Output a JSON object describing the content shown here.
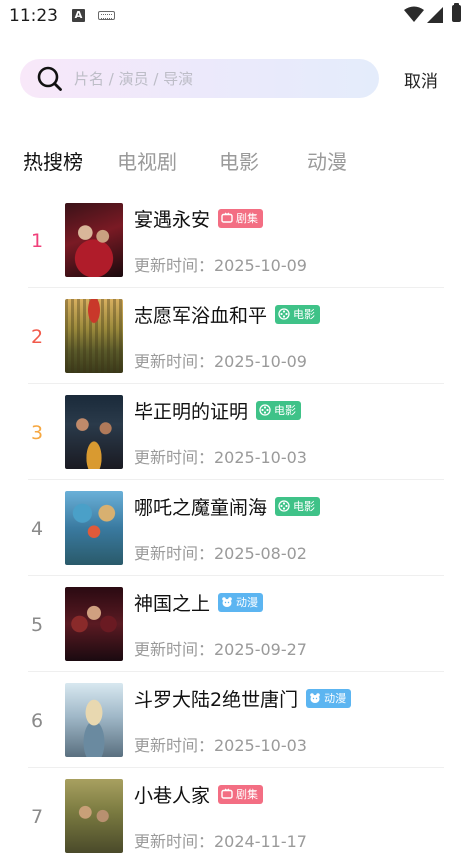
{
  "status_bar": {
    "time": "11:23",
    "notification_letter": "A"
  },
  "search": {
    "placeholder": "片名 / 演员 / 导演",
    "value": "",
    "cancel_label": "取消"
  },
  "tabs": [
    {
      "label": "热搜榜",
      "active": true
    },
    {
      "label": "电视剧",
      "active": false
    },
    {
      "label": "电影",
      "active": false
    },
    {
      "label": "动漫",
      "active": false
    }
  ],
  "list": [
    {
      "rank": "1",
      "title": "宴遇永安",
      "badge": "剧集",
      "badge_type": "series",
      "updated": "更新时间：2025-10-09",
      "rank_color": "#f0407a"
    },
    {
      "rank": "2",
      "title": "志愿军浴血和平",
      "badge": "电影",
      "badge_type": "movie",
      "updated": "更新时间：2025-10-09",
      "rank_color": "#f15a4b"
    },
    {
      "rank": "3",
      "title": "毕正明的证明",
      "badge": "电影",
      "badge_type": "movie",
      "updated": "更新时间：2025-10-03",
      "rank_color": "#f6a740"
    },
    {
      "rank": "4",
      "title": "哪吒之魔童闹海",
      "badge": "电影",
      "badge_type": "movie",
      "updated": "更新时间：2025-08-02",
      "rank_color": "#8a8a8a"
    },
    {
      "rank": "5",
      "title": "神国之上",
      "badge": "动漫",
      "badge_type": "anime",
      "updated": "更新时间：2025-09-27",
      "rank_color": "#8a8a8a"
    },
    {
      "rank": "6",
      "title": "斗罗大陆2绝世唐门",
      "badge": "动漫",
      "badge_type": "anime",
      "updated": "更新时间：2025-10-03",
      "rank_color": "#8a8a8a"
    },
    {
      "rank": "7",
      "title": "小巷人家",
      "badge": "剧集",
      "badge_type": "series",
      "updated": "更新时间：2024-11-17",
      "rank_color": "#8a8a8a"
    }
  ],
  "colors": {
    "badge_series": "#f36e83",
    "badge_movie": "#3fc288",
    "badge_anime": "#5cb5f1"
  }
}
